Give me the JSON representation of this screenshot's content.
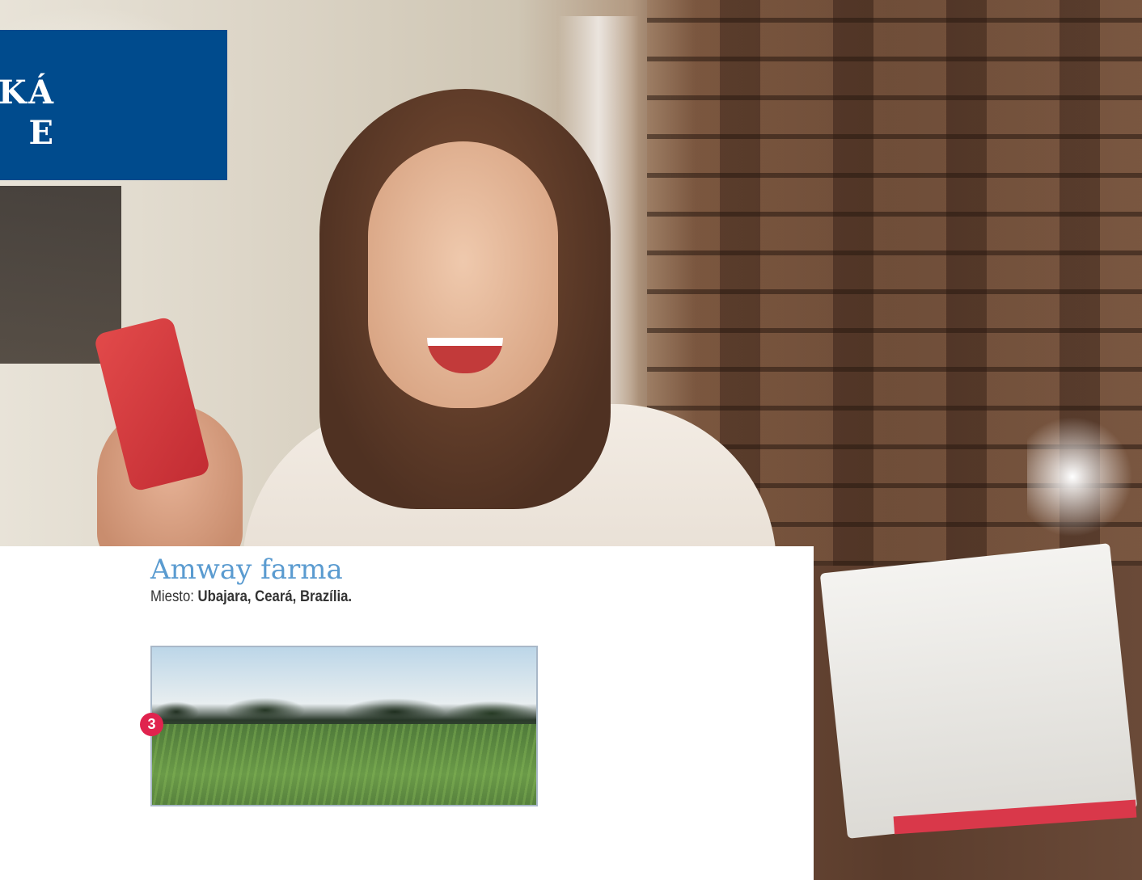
{
  "title_block": {
    "line1": "KÁ",
    "line2": "E"
  },
  "farm": {
    "title": "Amway farma",
    "location_label": "Miesto:",
    "location_value": "Ubajara, Ceará, Brazília."
  },
  "badge": {
    "number": "3"
  },
  "colors": {
    "title_block_bg": "#004b8d",
    "farm_title": "#5a9bd0",
    "badge_bg": "#e0234e"
  }
}
